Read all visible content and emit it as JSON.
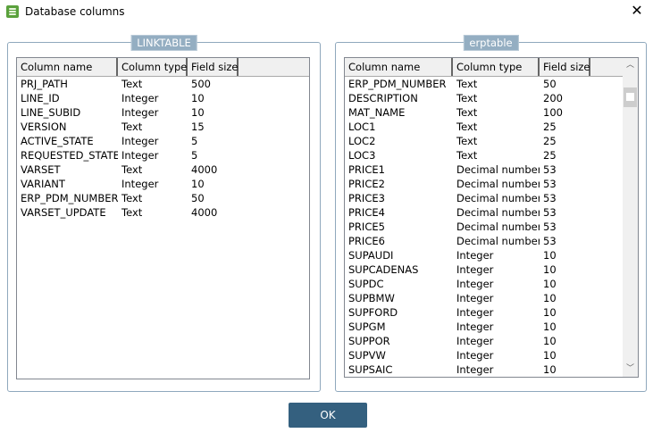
{
  "window": {
    "title": "Database columns",
    "icon": "database-icon",
    "close_icon": "close-icon"
  },
  "left": {
    "legend": "LINKTABLE",
    "headers": [
      "Column name",
      "Column type",
      "Field size"
    ],
    "rows": [
      [
        "PRJ_PATH",
        "Text",
        "500"
      ],
      [
        "LINE_ID",
        "Integer",
        "10"
      ],
      [
        "LINE_SUBID",
        "Integer",
        "10"
      ],
      [
        "VERSION",
        "Text",
        "15"
      ],
      [
        "ACTIVE_STATE",
        "Integer",
        "5"
      ],
      [
        "REQUESTED_STATE",
        "Integer",
        "5"
      ],
      [
        "VARSET",
        "Text",
        "4000"
      ],
      [
        "VARIANT",
        "Integer",
        "10"
      ],
      [
        "ERP_PDM_NUMBER",
        "Text",
        "50"
      ],
      [
        "VARSET_UPDATE",
        "Text",
        "4000"
      ]
    ]
  },
  "right": {
    "legend": "erptable",
    "headers": [
      "Column name",
      "Column type",
      "Field size"
    ],
    "rows": [
      [
        "ERP_PDM_NUMBER",
        "Text",
        "50"
      ],
      [
        "DESCRIPTION",
        "Text",
        "200"
      ],
      [
        "MAT_NAME",
        "Text",
        "100"
      ],
      [
        "LOC1",
        "Text",
        "25"
      ],
      [
        "LOC2",
        "Text",
        "25"
      ],
      [
        "LOC3",
        "Text",
        "25"
      ],
      [
        "PRICE1",
        "Decimal number",
        "53"
      ],
      [
        "PRICE2",
        "Decimal number",
        "53"
      ],
      [
        "PRICE3",
        "Decimal number",
        "53"
      ],
      [
        "PRICE4",
        "Decimal number",
        "53"
      ],
      [
        "PRICE5",
        "Decimal number",
        "53"
      ],
      [
        "PRICE6",
        "Decimal number",
        "53"
      ],
      [
        "SUPAUDI",
        "Integer",
        "10"
      ],
      [
        "SUPCADENAS",
        "Integer",
        "10"
      ],
      [
        "SUPDC",
        "Integer",
        "10"
      ],
      [
        "SUPBMW",
        "Integer",
        "10"
      ],
      [
        "SUPFORD",
        "Integer",
        "10"
      ],
      [
        "SUPGM",
        "Integer",
        "10"
      ],
      [
        "SUPPOR",
        "Integer",
        "10"
      ],
      [
        "SUPVW",
        "Integer",
        "10"
      ],
      [
        "SUPSAIC",
        "Integer",
        "10"
      ]
    ],
    "scroll_position": 0.05
  },
  "ok_label": "OK"
}
